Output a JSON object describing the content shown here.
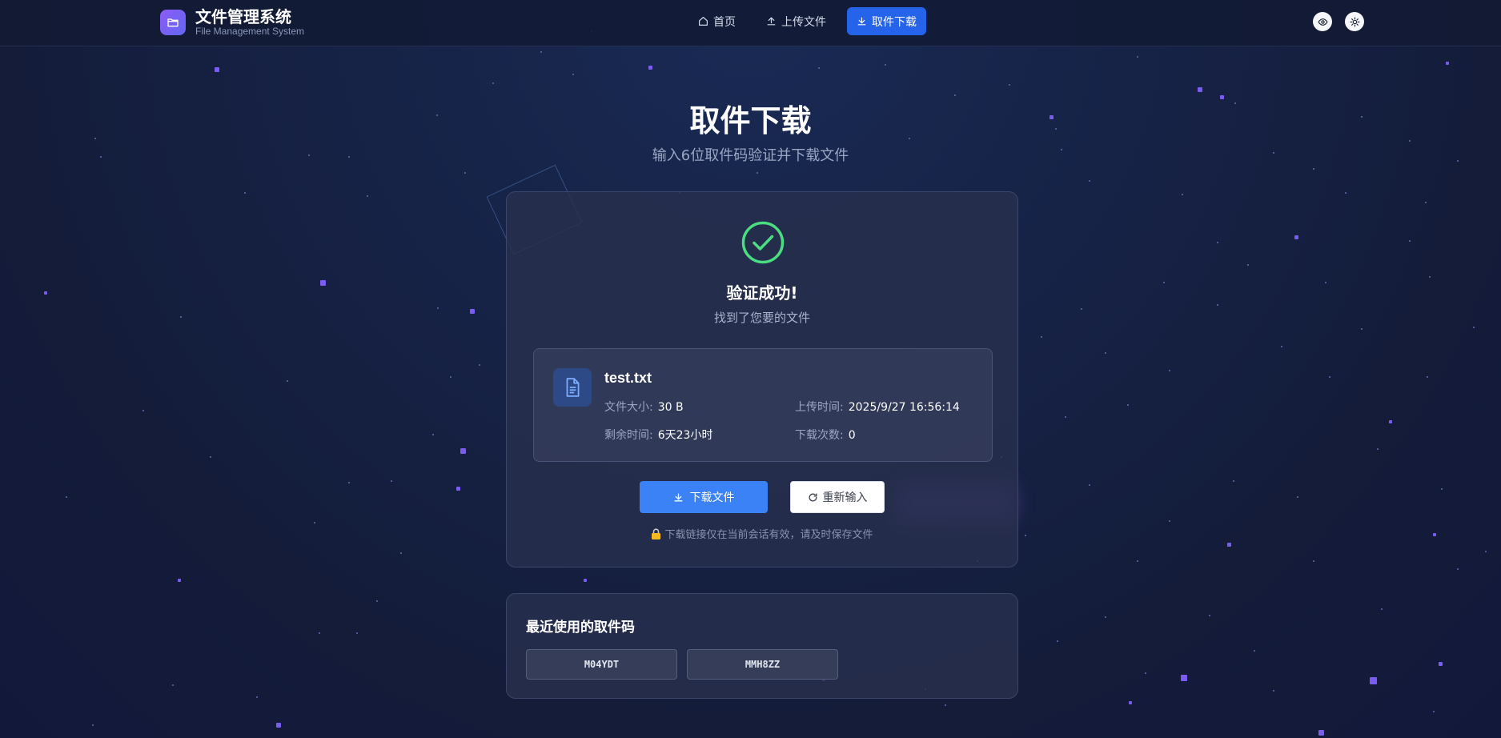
{
  "header": {
    "app_title": "文件管理系统",
    "app_subtitle": "File Management System",
    "nav": [
      {
        "label": "首页",
        "icon": "home-icon",
        "active": false
      },
      {
        "label": "上传文件",
        "icon": "upload-icon",
        "active": false
      },
      {
        "label": "取件下载",
        "icon": "download-icon",
        "active": true
      }
    ],
    "actions": [
      {
        "icon": "eye-icon"
      },
      {
        "icon": "sun-icon"
      }
    ]
  },
  "page": {
    "title": "取件下载",
    "subtitle": "输入6位取件码验证并下载文件"
  },
  "result": {
    "status_icon": "check-circle-icon",
    "title": "验证成功!",
    "subtitle": "找到了您要的文件",
    "file": {
      "icon": "document-icon",
      "name": "test.txt",
      "size_label": "文件大小:",
      "size_value": "30 B",
      "upload_label": "上传时间:",
      "upload_value": "2025/9/27 16:56:14",
      "remaining_label": "剩余时间:",
      "remaining_value": "6天23小时",
      "downloads_label": "下载次数:",
      "downloads_value": "0"
    },
    "download_button": "下载文件",
    "reset_button": "重新输入",
    "note": "下载链接仅在当前会话有效，请及时保存文件"
  },
  "recent": {
    "title": "最近使用的取件码",
    "codes": [
      "M04YDT",
      "MMH8ZZ"
    ]
  },
  "colors": {
    "accent": "#3b82f6",
    "nav_active": "#2563eb",
    "success": "#4ade80",
    "star": "#7b5cf0",
    "background": "#151d3d"
  }
}
